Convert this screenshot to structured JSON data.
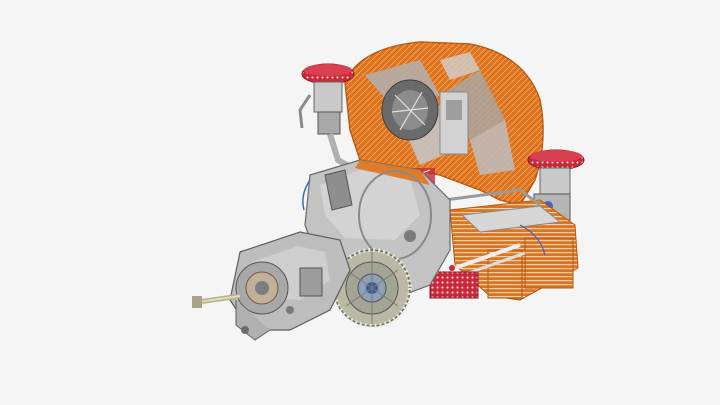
{
  "scene": {
    "subject": "engine-cad-model",
    "background_color": "#f5f5f6",
    "colors": {
      "orange": "#e0741c",
      "orange_dark": "#b8560e",
      "grey_light": "#c9c9c9",
      "grey_mid": "#9a9a9a",
      "grey_dark": "#5e5e5e",
      "red": "#c8283a",
      "white": "#eeeeee"
    }
  }
}
